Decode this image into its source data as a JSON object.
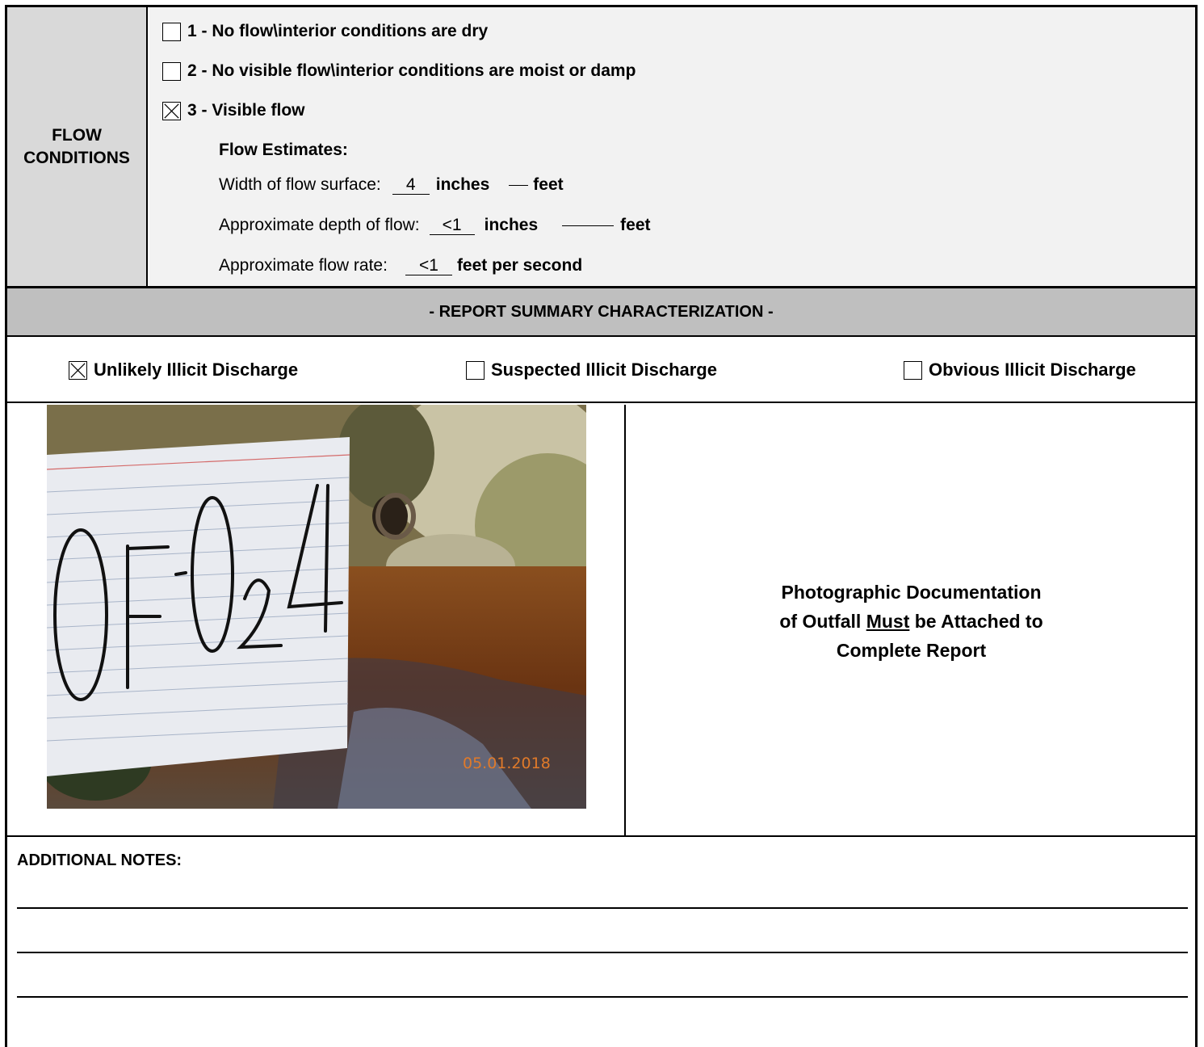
{
  "flow": {
    "label_line1": "FLOW",
    "label_line2": "CONDITIONS",
    "options": [
      {
        "label": "1 - No flow\\interior conditions are dry",
        "checked": false
      },
      {
        "label": "2 - No visible flow\\interior conditions are moist or damp",
        "checked": false
      },
      {
        "label": "3 - Visible flow",
        "checked": true
      }
    ],
    "estimates_title": "Flow Estimates:",
    "width_label": "Width of flow surface:",
    "width_inches_value": "4",
    "width_feet_value": "",
    "depth_label": "Approximate depth of flow:",
    "depth_inches_value": "<1",
    "depth_feet_value": "",
    "rate_label": "Approximate flow rate:",
    "rate_value": "<1",
    "unit_inches": "inches",
    "unit_feet": "feet",
    "unit_fps": "feet per second"
  },
  "summary": {
    "title": "- REPORT SUMMARY CHARACTERIZATION -",
    "choices": [
      {
        "label": "Unlikely Illicit Discharge",
        "checked": true
      },
      {
        "label": "Suspected Illicit Discharge",
        "checked": false
      },
      {
        "label": "Obvious Illicit Discharge",
        "checked": false
      }
    ]
  },
  "photo": {
    "card_text": "OF-024",
    "date_stamp": "05.01.2018",
    "note_line1": "Photographic Documentation",
    "note_line2_pre": "of Outfall ",
    "note_line2_u": "Must",
    "note_line2_post": " be Attached to",
    "note_line3": "Complete Report"
  },
  "notes": {
    "title": "ADDITIONAL NOTES:"
  }
}
